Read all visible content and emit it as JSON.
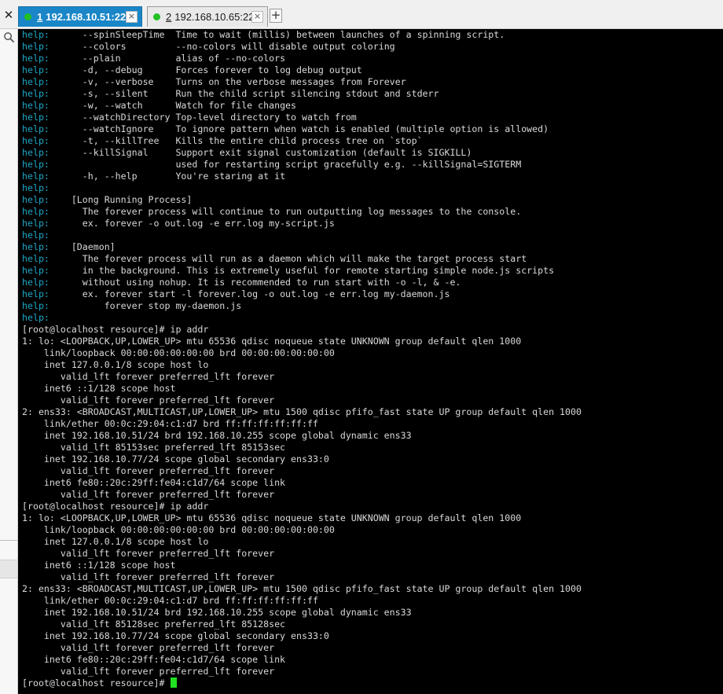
{
  "tabs": [
    {
      "number": "1",
      "label": " 192.168.10.51:22",
      "active": true,
      "status_color": "#22c022",
      "close_label": "×"
    },
    {
      "number": "2",
      "label": " 192.168.10.65:22",
      "active": false,
      "status_color": "#22c022",
      "close_label": "×"
    }
  ],
  "tabbar": {
    "close_label": "✕",
    "add_label": "+"
  },
  "sidebar": {
    "search_icon": "search-icon"
  },
  "colors": {
    "help_prefix": "#1fa8c9",
    "terminal_text": "#d9d9d9",
    "terminal_bg": "#000000",
    "cursor": "#21e021",
    "active_tab": "#1a86c8"
  },
  "terminal": {
    "lines": [
      {
        "prefix": "help:",
        "text": "      --spinSleepTime  Time to wait (millis) between launches of a spinning script."
      },
      {
        "prefix": "help:",
        "text": "      --colors         --no-colors will disable output coloring"
      },
      {
        "prefix": "help:",
        "text": "      --plain          alias of --no-colors"
      },
      {
        "prefix": "help:",
        "text": "      -d, --debug      Forces forever to log debug output"
      },
      {
        "prefix": "help:",
        "text": "      -v, --verbose    Turns on the verbose messages from Forever"
      },
      {
        "prefix": "help:",
        "text": "      -s, --silent     Run the child script silencing stdout and stderr"
      },
      {
        "prefix": "help:",
        "text": "      -w, --watch      Watch for file changes"
      },
      {
        "prefix": "help:",
        "text": "      --watchDirectory Top-level directory to watch from"
      },
      {
        "prefix": "help:",
        "text": "      --watchIgnore    To ignore pattern when watch is enabled (multiple option is allowed)"
      },
      {
        "prefix": "help:",
        "text": "      -t, --killTree   Kills the entire child process tree on `stop`"
      },
      {
        "prefix": "help:",
        "text": "      --killSignal     Support exit signal customization (default is SIGKILL)"
      },
      {
        "prefix": "help:",
        "text": "                       used for restarting script gracefully e.g. --killSignal=SIGTERM"
      },
      {
        "prefix": "help:",
        "text": "      -h, --help       You're staring at it"
      },
      {
        "prefix": "help:",
        "text": ""
      },
      {
        "prefix": "help:",
        "text": "    [Long Running Process]"
      },
      {
        "prefix": "help:",
        "text": "      The forever process will continue to run outputting log messages to the console."
      },
      {
        "prefix": "help:",
        "text": "      ex. forever -o out.log -e err.log my-script.js"
      },
      {
        "prefix": "help:",
        "text": ""
      },
      {
        "prefix": "help:",
        "text": "    [Daemon]"
      },
      {
        "prefix": "help:",
        "text": "      The forever process will run as a daemon which will make the target process start"
      },
      {
        "prefix": "help:",
        "text": "      in the background. This is extremely useful for remote starting simple node.js scripts"
      },
      {
        "prefix": "help:",
        "text": "      without using nohup. It is recommended to run start with -o -l, & -e."
      },
      {
        "prefix": "help:",
        "text": "      ex. forever start -l forever.log -o out.log -e err.log my-daemon.js"
      },
      {
        "prefix": "help:",
        "text": "          forever stop my-daemon.js"
      },
      {
        "prefix": "help:",
        "text": ""
      },
      {
        "prefix": "",
        "text": "[root@localhost resource]# ip addr"
      },
      {
        "prefix": "",
        "text": "1: lo: <LOOPBACK,UP,LOWER_UP> mtu 65536 qdisc noqueue state UNKNOWN group default qlen 1000"
      },
      {
        "prefix": "",
        "text": "    link/loopback 00:00:00:00:00:00 brd 00:00:00:00:00:00"
      },
      {
        "prefix": "",
        "text": "    inet 127.0.0.1/8 scope host lo"
      },
      {
        "prefix": "",
        "text": "       valid_lft forever preferred_lft forever"
      },
      {
        "prefix": "",
        "text": "    inet6 ::1/128 scope host"
      },
      {
        "prefix": "",
        "text": "       valid_lft forever preferred_lft forever"
      },
      {
        "prefix": "",
        "text": "2: ens33: <BROADCAST,MULTICAST,UP,LOWER_UP> mtu 1500 qdisc pfifo_fast state UP group default qlen 1000"
      },
      {
        "prefix": "",
        "text": "    link/ether 00:0c:29:04:c1:d7 brd ff:ff:ff:ff:ff:ff"
      },
      {
        "prefix": "",
        "text": "    inet 192.168.10.51/24 brd 192.168.10.255 scope global dynamic ens33"
      },
      {
        "prefix": "",
        "text": "       valid_lft 85153sec preferred_lft 85153sec"
      },
      {
        "prefix": "",
        "text": "    inet 192.168.10.77/24 scope global secondary ens33:0"
      },
      {
        "prefix": "",
        "text": "       valid_lft forever preferred_lft forever"
      },
      {
        "prefix": "",
        "text": "    inet6 fe80::20c:29ff:fe04:c1d7/64 scope link"
      },
      {
        "prefix": "",
        "text": "       valid_lft forever preferred_lft forever"
      },
      {
        "prefix": "",
        "text": "[root@localhost resource]# ip addr"
      },
      {
        "prefix": "",
        "text": "1: lo: <LOOPBACK,UP,LOWER_UP> mtu 65536 qdisc noqueue state UNKNOWN group default qlen 1000"
      },
      {
        "prefix": "",
        "text": "    link/loopback 00:00:00:00:00:00 brd 00:00:00:00:00:00"
      },
      {
        "prefix": "",
        "text": "    inet 127.0.0.1/8 scope host lo"
      },
      {
        "prefix": "",
        "text": "       valid_lft forever preferred_lft forever"
      },
      {
        "prefix": "",
        "text": "    inet6 ::1/128 scope host"
      },
      {
        "prefix": "",
        "text": "       valid_lft forever preferred_lft forever"
      },
      {
        "prefix": "",
        "text": "2: ens33: <BROADCAST,MULTICAST,UP,LOWER_UP> mtu 1500 qdisc pfifo_fast state UP group default qlen 1000"
      },
      {
        "prefix": "",
        "text": "    link/ether 00:0c:29:04:c1:d7 brd ff:ff:ff:ff:ff:ff"
      },
      {
        "prefix": "",
        "text": "    inet 192.168.10.51/24 brd 192.168.10.255 scope global dynamic ens33"
      },
      {
        "prefix": "",
        "text": "       valid_lft 85128sec preferred_lft 85128sec"
      },
      {
        "prefix": "",
        "text": "    inet 192.168.10.77/24 scope global secondary ens33:0"
      },
      {
        "prefix": "",
        "text": "       valid_lft forever preferred_lft forever"
      },
      {
        "prefix": "",
        "text": "    inet6 fe80::20c:29ff:fe04:c1d7/64 scope link"
      },
      {
        "prefix": "",
        "text": "       valid_lft forever preferred_lft forever"
      },
      {
        "prefix": "",
        "text": "[root@localhost resource]# "
      }
    ]
  }
}
